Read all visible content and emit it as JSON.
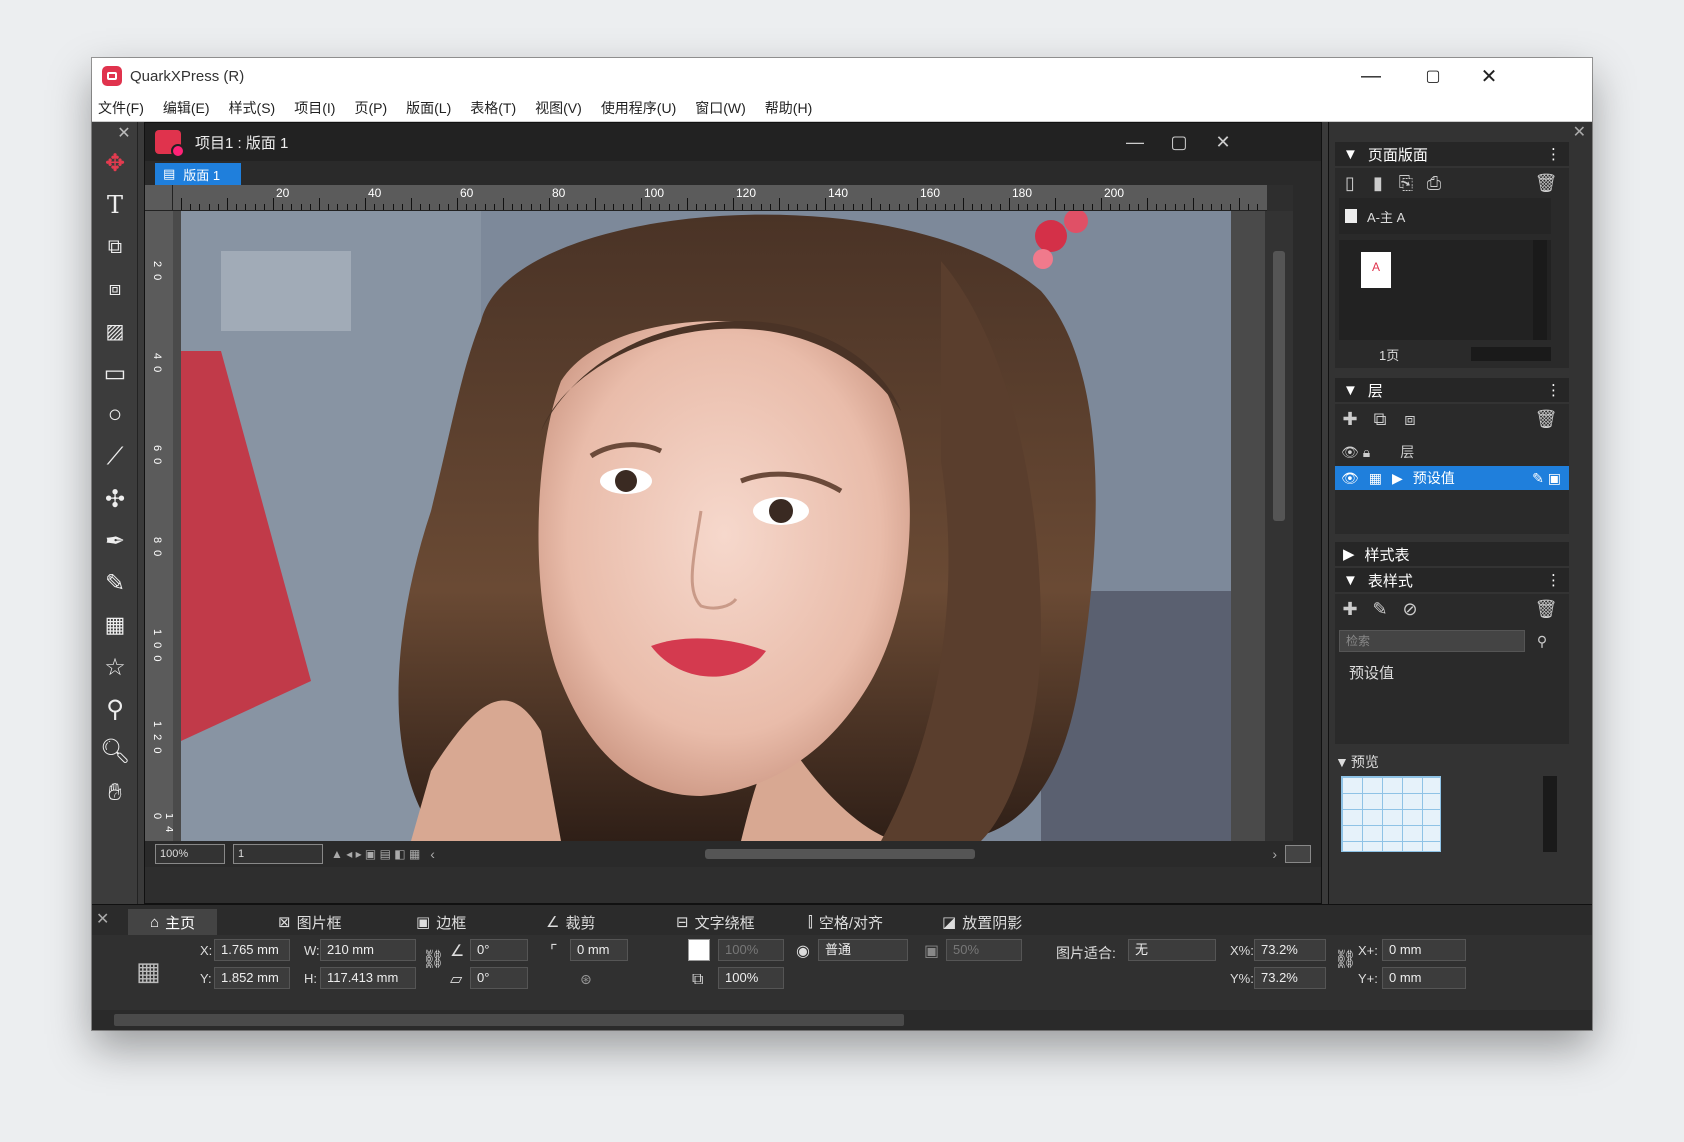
{
  "app": {
    "title": "QuarkXPress (R)"
  },
  "menu": [
    "文件(F)",
    "编辑(E)",
    "样式(S)",
    "项目(I)",
    "页(P)",
    "版面(L)",
    "表格(T)",
    "视图(V)",
    "使用程序(U)",
    "窗口(W)",
    "帮助(H)"
  ],
  "document": {
    "title": "项目1 : 版面 1",
    "tab": "版面 1"
  },
  "ruler": {
    "h_labels": [
      "20",
      "40",
      "60",
      "80",
      "100",
      "120",
      "140",
      "160",
      "180",
      "200"
    ],
    "v_labels": [
      "2 0",
      "4 0",
      "6 0",
      "8 0",
      "1 0 0",
      "1 2 0",
      "1 4 0"
    ]
  },
  "status": {
    "zoom": "100%",
    "page": "1"
  },
  "panels": {
    "page_layout": {
      "title": "页面版面",
      "master": "A-主 A",
      "thumb_letter": "A",
      "page_label": "1页"
    },
    "layers": {
      "title": "层",
      "header": "层",
      "row": "预设值"
    },
    "style_sheets": {
      "title": "样式表"
    },
    "table_styles": {
      "title": "表样式",
      "search_placeholder": "检索",
      "item": "预设值"
    },
    "preview": {
      "title": "预览"
    }
  },
  "measure": {
    "tabs": [
      "主页",
      "图片框",
      "边框",
      "裁剪",
      "文字绕框",
      "空格/对齐",
      "放置阴影"
    ],
    "x_label": "X:",
    "x_value": "1.765 mm",
    "y_label": "Y:",
    "y_value": "1.852 mm",
    "w_label": "W:",
    "w_value": "210 mm",
    "h_label": "H:",
    "h_value": "117.413 mm",
    "angle_value": "0°",
    "skew_value": "0°",
    "corner_value": "0 mm",
    "opacity_dim": "100%",
    "opacity": "100%",
    "blend": "普通",
    "shade_dim": "50%",
    "fit_label": "图片适合:",
    "fit_value": "无",
    "xpct_label": "X%:",
    "xpct_value": "73.2%",
    "ypct_label": "Y%:",
    "ypct_value": "73.2%",
    "xplus_label": "X+:",
    "xplus_value": "0 mm",
    "yplus_label": "Y+:",
    "yplus_value": "0 mm"
  }
}
